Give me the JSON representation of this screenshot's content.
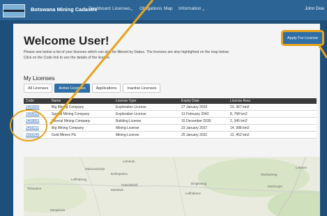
{
  "nav": {
    "brand": "Botswana Mining Cadastre",
    "items": [
      "Dashboard",
      "Licenses",
      "Obligations",
      "Map",
      "Information"
    ],
    "user": "John Doe"
  },
  "page": {
    "title": "Welcome User!",
    "intro_line1": "Please see below a list of your licenses which can also be filtered by Status. The licenses are also highlighted on the map below.",
    "intro_line2": "Click on the Code link to see the details of the license.",
    "apply_button": "Apply For License"
  },
  "licenses": {
    "heading": "My Licenses",
    "tabs": [
      "All Licenses",
      "Active Licenses",
      "Applications",
      "Inactive Licenses"
    ],
    "active_tab": "Active Licenses",
    "columns": [
      "Code",
      "Name",
      "License Type",
      "Expiry Date",
      "License Area"
    ],
    "rows": [
      [
        "2402893",
        "Big Mining Company",
        "Exploration License",
        "27 January 2033",
        "23, 367 km2"
      ],
      [
        "2408023",
        "Spatial Mining Company",
        "Exploration License",
        "13 February 2042",
        "8, 768 km2"
      ],
      [
        "2408853",
        "Mineral Mining Company",
        "Building License",
        "15 December 2030",
        "2, 345 km2"
      ],
      [
        "2458211",
        "Big Mining Company",
        "Mining License",
        "23 January 2027",
        "14, 998 km2"
      ],
      [
        "2058240",
        "Gold Miners Plc",
        "Mining License",
        "25 January 2031",
        "12, 452 km2"
      ]
    ]
  },
  "map": {
    "places": [
      "Lehututu",
      "Mabuasehube",
      "Bothapatlou",
      "Letlhakeng",
      "Tshwaane",
      "Hatsalatladi",
      "Dingkweng",
      "Motokwe",
      "Moshaneng",
      "Letlhakane",
      "Moshoope",
      "Lotsane",
      "Mmaphula"
    ]
  },
  "colors": {
    "navbar": "#2b6495",
    "accent": "#2f6fa6",
    "annotation": "#e8a31b"
  }
}
